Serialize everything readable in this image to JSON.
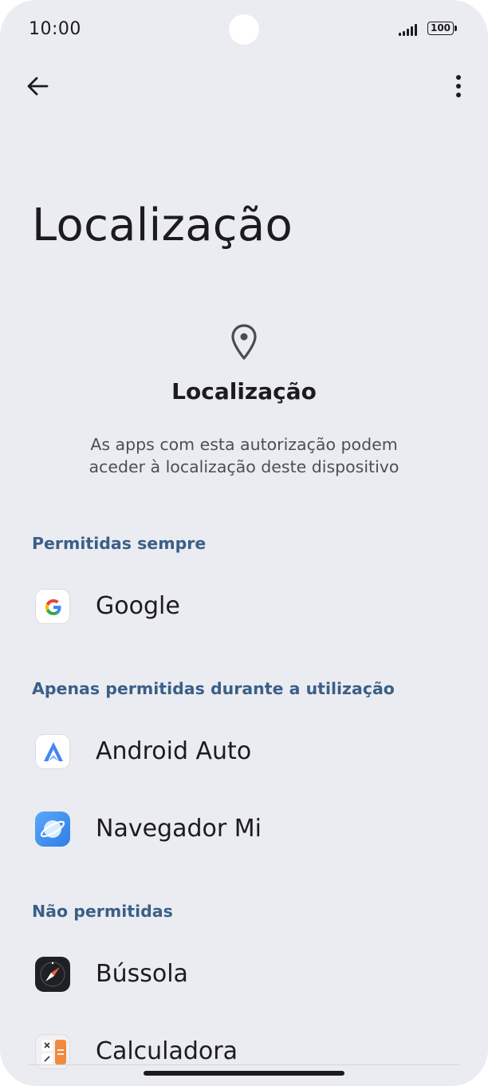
{
  "status_bar": {
    "time": "10:00",
    "battery": "100"
  },
  "toolbar": {
    "back_icon": "arrow-left-icon",
    "menu_icon": "more-vert-icon"
  },
  "page": {
    "title": "Localização"
  },
  "header": {
    "icon": "location-pin-icon",
    "title": "Localização",
    "description_line1": "As apps com esta autorização podem",
    "description_line2": "aceder à localização deste dispositivo"
  },
  "sections": [
    {
      "label": "Permitidas sempre",
      "apps": [
        {
          "name": "Google",
          "icon": "google-icon"
        }
      ]
    },
    {
      "label": "Apenas permitidas durante a utilização",
      "apps": [
        {
          "name": "Android Auto",
          "icon": "android-auto-icon"
        },
        {
          "name": "Navegador Mi",
          "icon": "navegador-mi-icon"
        }
      ]
    },
    {
      "label": "Não permitidas",
      "apps": [
        {
          "name": "Bússola",
          "icon": "compass-icon"
        },
        {
          "name": "Calculadora",
          "icon": "calculator-icon"
        }
      ]
    }
  ],
  "colors": {
    "background": "#ebecf1",
    "section_label": "#3a5f88",
    "text": "#1c1c1e"
  }
}
